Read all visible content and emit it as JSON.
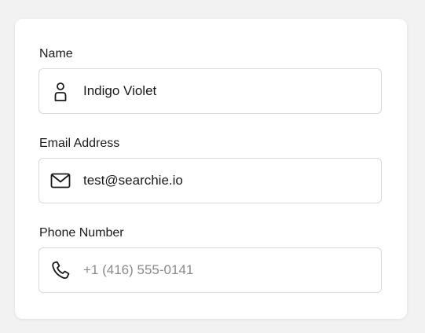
{
  "form": {
    "name": {
      "label": "Name",
      "value": "Indigo Violet",
      "placeholder": "",
      "icon": "user-icon"
    },
    "email": {
      "label": "Email Address",
      "value": "test@searchie.io",
      "placeholder": "",
      "icon": "mail-icon"
    },
    "phone": {
      "label": "Phone Number",
      "value": "",
      "placeholder": "+1 (416) 555-0141",
      "icon": "phone-icon"
    }
  },
  "colors": {
    "background": "#f2f2f2",
    "card": "#ffffff",
    "border": "#d9d9d9",
    "text": "#1a1a1a",
    "placeholder": "#8a8a8a"
  }
}
